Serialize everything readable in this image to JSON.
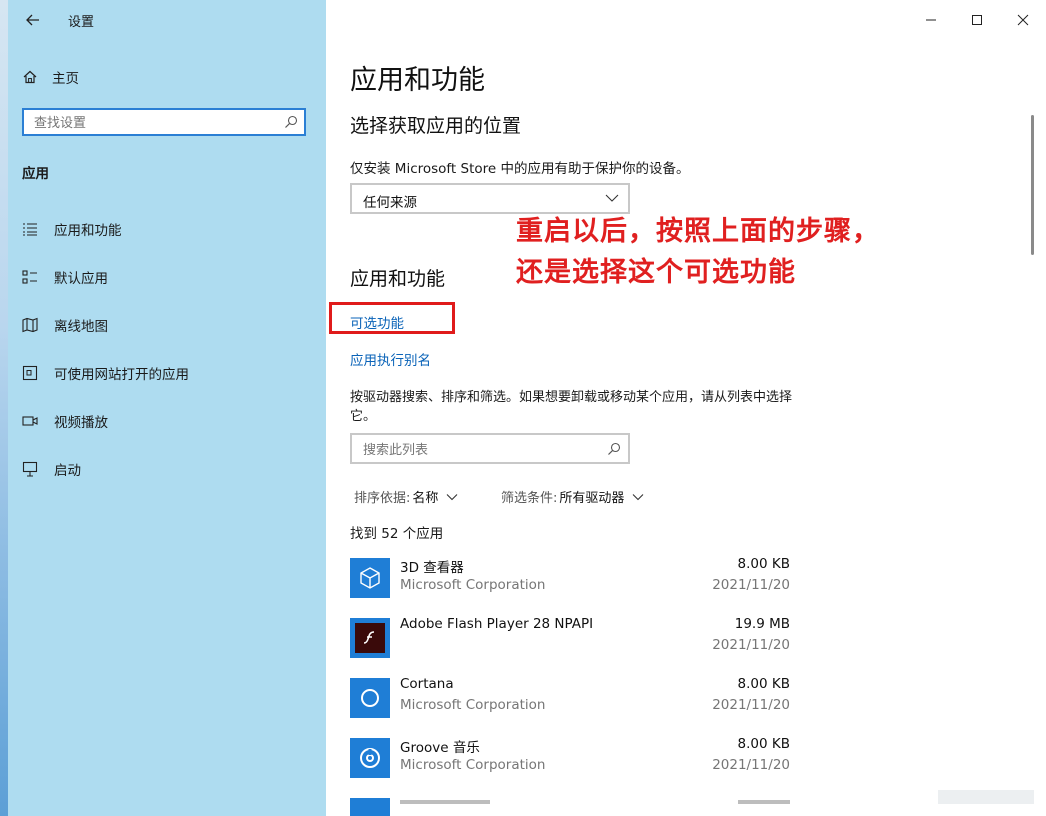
{
  "window": {
    "title": "设置",
    "caption": {
      "minimize": "minimize-icon",
      "maximize": "maximize-icon",
      "close": "close-icon"
    }
  },
  "sidebar": {
    "home_label": "主页",
    "search_placeholder": "查找设置",
    "section_title": "应用",
    "items": [
      {
        "label": "应用和功能",
        "icon": "list-icon"
      },
      {
        "label": "默认应用",
        "icon": "default-apps-icon"
      },
      {
        "label": "离线地图",
        "icon": "map-icon"
      },
      {
        "label": "可使用网站打开的应用",
        "icon": "web-app-icon"
      },
      {
        "label": "视频播放",
        "icon": "video-icon"
      },
      {
        "label": "启动",
        "icon": "startup-icon"
      }
    ]
  },
  "main": {
    "title": "应用和功能",
    "install_section_title": "选择获取应用的位置",
    "install_desc": "仅安装 Microsoft Store 中的应用有助于保护你的设备。",
    "install_source": "任何来源",
    "annotation_line1": "重启以后，按照上面的步骤，",
    "annotation_line2": "还是选择这个可选功能",
    "apps_section_title": "应用和功能",
    "optional_features_link": "可选功能",
    "app_alias_link": "应用执行别名",
    "list_desc": "按驱动器搜索、排序和筛选。如果想要卸载或移动某个应用，请从列表中选择它。",
    "list_search_placeholder": "搜索此列表",
    "sort_label": "排序依据:",
    "sort_value": "名称",
    "filter_label": "筛选条件:",
    "filter_value": "所有驱动器",
    "count_text": "找到 52 个应用",
    "apps": [
      {
        "name": "3D 查看器",
        "publisher": "Microsoft Corporation",
        "size": "8.00 KB",
        "date": "2021/11/20",
        "icon": "3d-viewer-icon",
        "tile_color": "#1f7ed6"
      },
      {
        "name": "Adobe Flash Player 28 NPAPI",
        "publisher": "",
        "size": "19.9 MB",
        "date": "2021/11/20",
        "icon": "flash-icon",
        "tile_color": "#1f7ed6"
      },
      {
        "name": "Cortana",
        "publisher": "Microsoft Corporation",
        "size": "8.00 KB",
        "date": "2021/11/20",
        "icon": "cortana-icon",
        "tile_color": "#1f7ed6"
      },
      {
        "name": "Groove 音乐",
        "publisher": "Microsoft Corporation",
        "size": "8.00 KB",
        "date": "2021/11/20",
        "icon": "groove-music-icon",
        "tile_color": "#1f7ed6"
      }
    ]
  },
  "colors": {
    "sidebar_bg": "#aedcf0",
    "accent": "#0a63b8",
    "annotation": "#e02020",
    "highlight_box": "#e01b1b"
  }
}
